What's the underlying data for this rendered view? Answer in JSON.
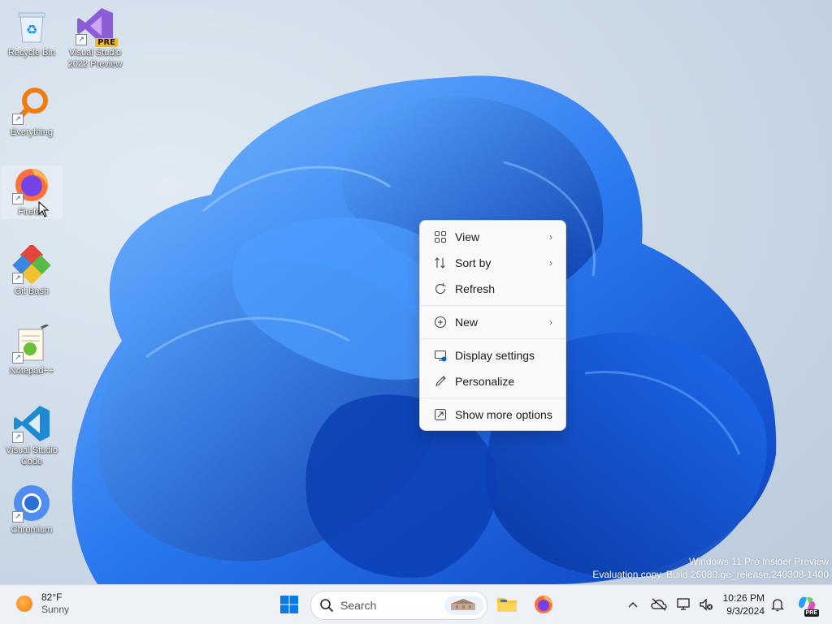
{
  "desktop": {
    "icons": [
      {
        "name": "recycle-bin",
        "label": "Recycle Bin"
      },
      {
        "name": "visual-studio",
        "label": "Visual Studio 2022 Preview",
        "badge": "PRE"
      },
      {
        "name": "everything",
        "label": "Everything"
      },
      {
        "name": "firefox",
        "label": "Firefox"
      },
      {
        "name": "git-bash",
        "label": "Git Bash"
      },
      {
        "name": "notepadpp",
        "label": "Notepad++"
      },
      {
        "name": "vscode",
        "label": "Visual Studio Code"
      },
      {
        "name": "chromium",
        "label": "Chromium"
      }
    ]
  },
  "context_menu": {
    "items": [
      {
        "label": "View",
        "icon": "grid-icon",
        "submenu": true
      },
      {
        "label": "Sort by",
        "icon": "sort-icon",
        "submenu": true
      },
      {
        "label": "Refresh",
        "icon": "refresh-icon",
        "submenu": false
      },
      {
        "label": "New",
        "icon": "plus-circle-icon",
        "submenu": true
      },
      {
        "label": "Display settings",
        "icon": "display-settings-icon",
        "submenu": false
      },
      {
        "label": "Personalize",
        "icon": "pen-icon",
        "submenu": false
      },
      {
        "label": "Show more options",
        "icon": "more-options-icon",
        "submenu": false
      }
    ],
    "chevron": "›"
  },
  "watermark": {
    "line1": "Windows 11 Pro Insider Preview",
    "line2": "Evaluation copy. Build 26080.ge_release.240308-1400"
  },
  "taskbar": {
    "weather": {
      "temp": "82°F",
      "condition": "Sunny"
    },
    "search": {
      "placeholder": "Search"
    },
    "clock": {
      "time": "10:26 PM",
      "date": "9/3/2024"
    },
    "copilot_badge": "PRE"
  },
  "colors": {
    "accent": "#0067c0",
    "wallpaper_blue": "#1a5fe6",
    "menu_bg": "#f9f9f9"
  }
}
